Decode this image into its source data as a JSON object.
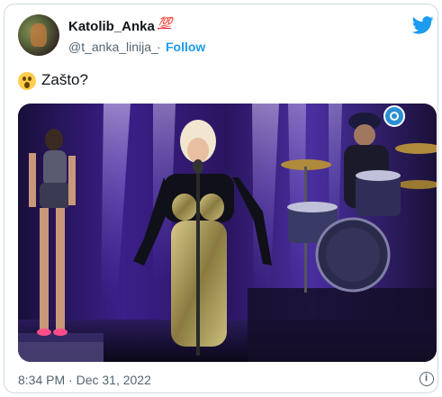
{
  "author": {
    "display_name": "Katolib_Anka",
    "badge_emoji": "💯",
    "handle": "@t_anka_linija_",
    "separator": "·",
    "follow_label": "Follow"
  },
  "tweet": {
    "emoji_icon": "astonished-face-icon",
    "text": "Zašto?",
    "timestamp": "8:34 PM · Dec 31, 2022"
  },
  "media": {
    "description_icon": "n1-channel-logo-icon"
  },
  "colors": {
    "accent": "#1d9bf0",
    "text_primary": "#0f1419",
    "text_secondary": "#536471",
    "border": "#cfd9de"
  }
}
